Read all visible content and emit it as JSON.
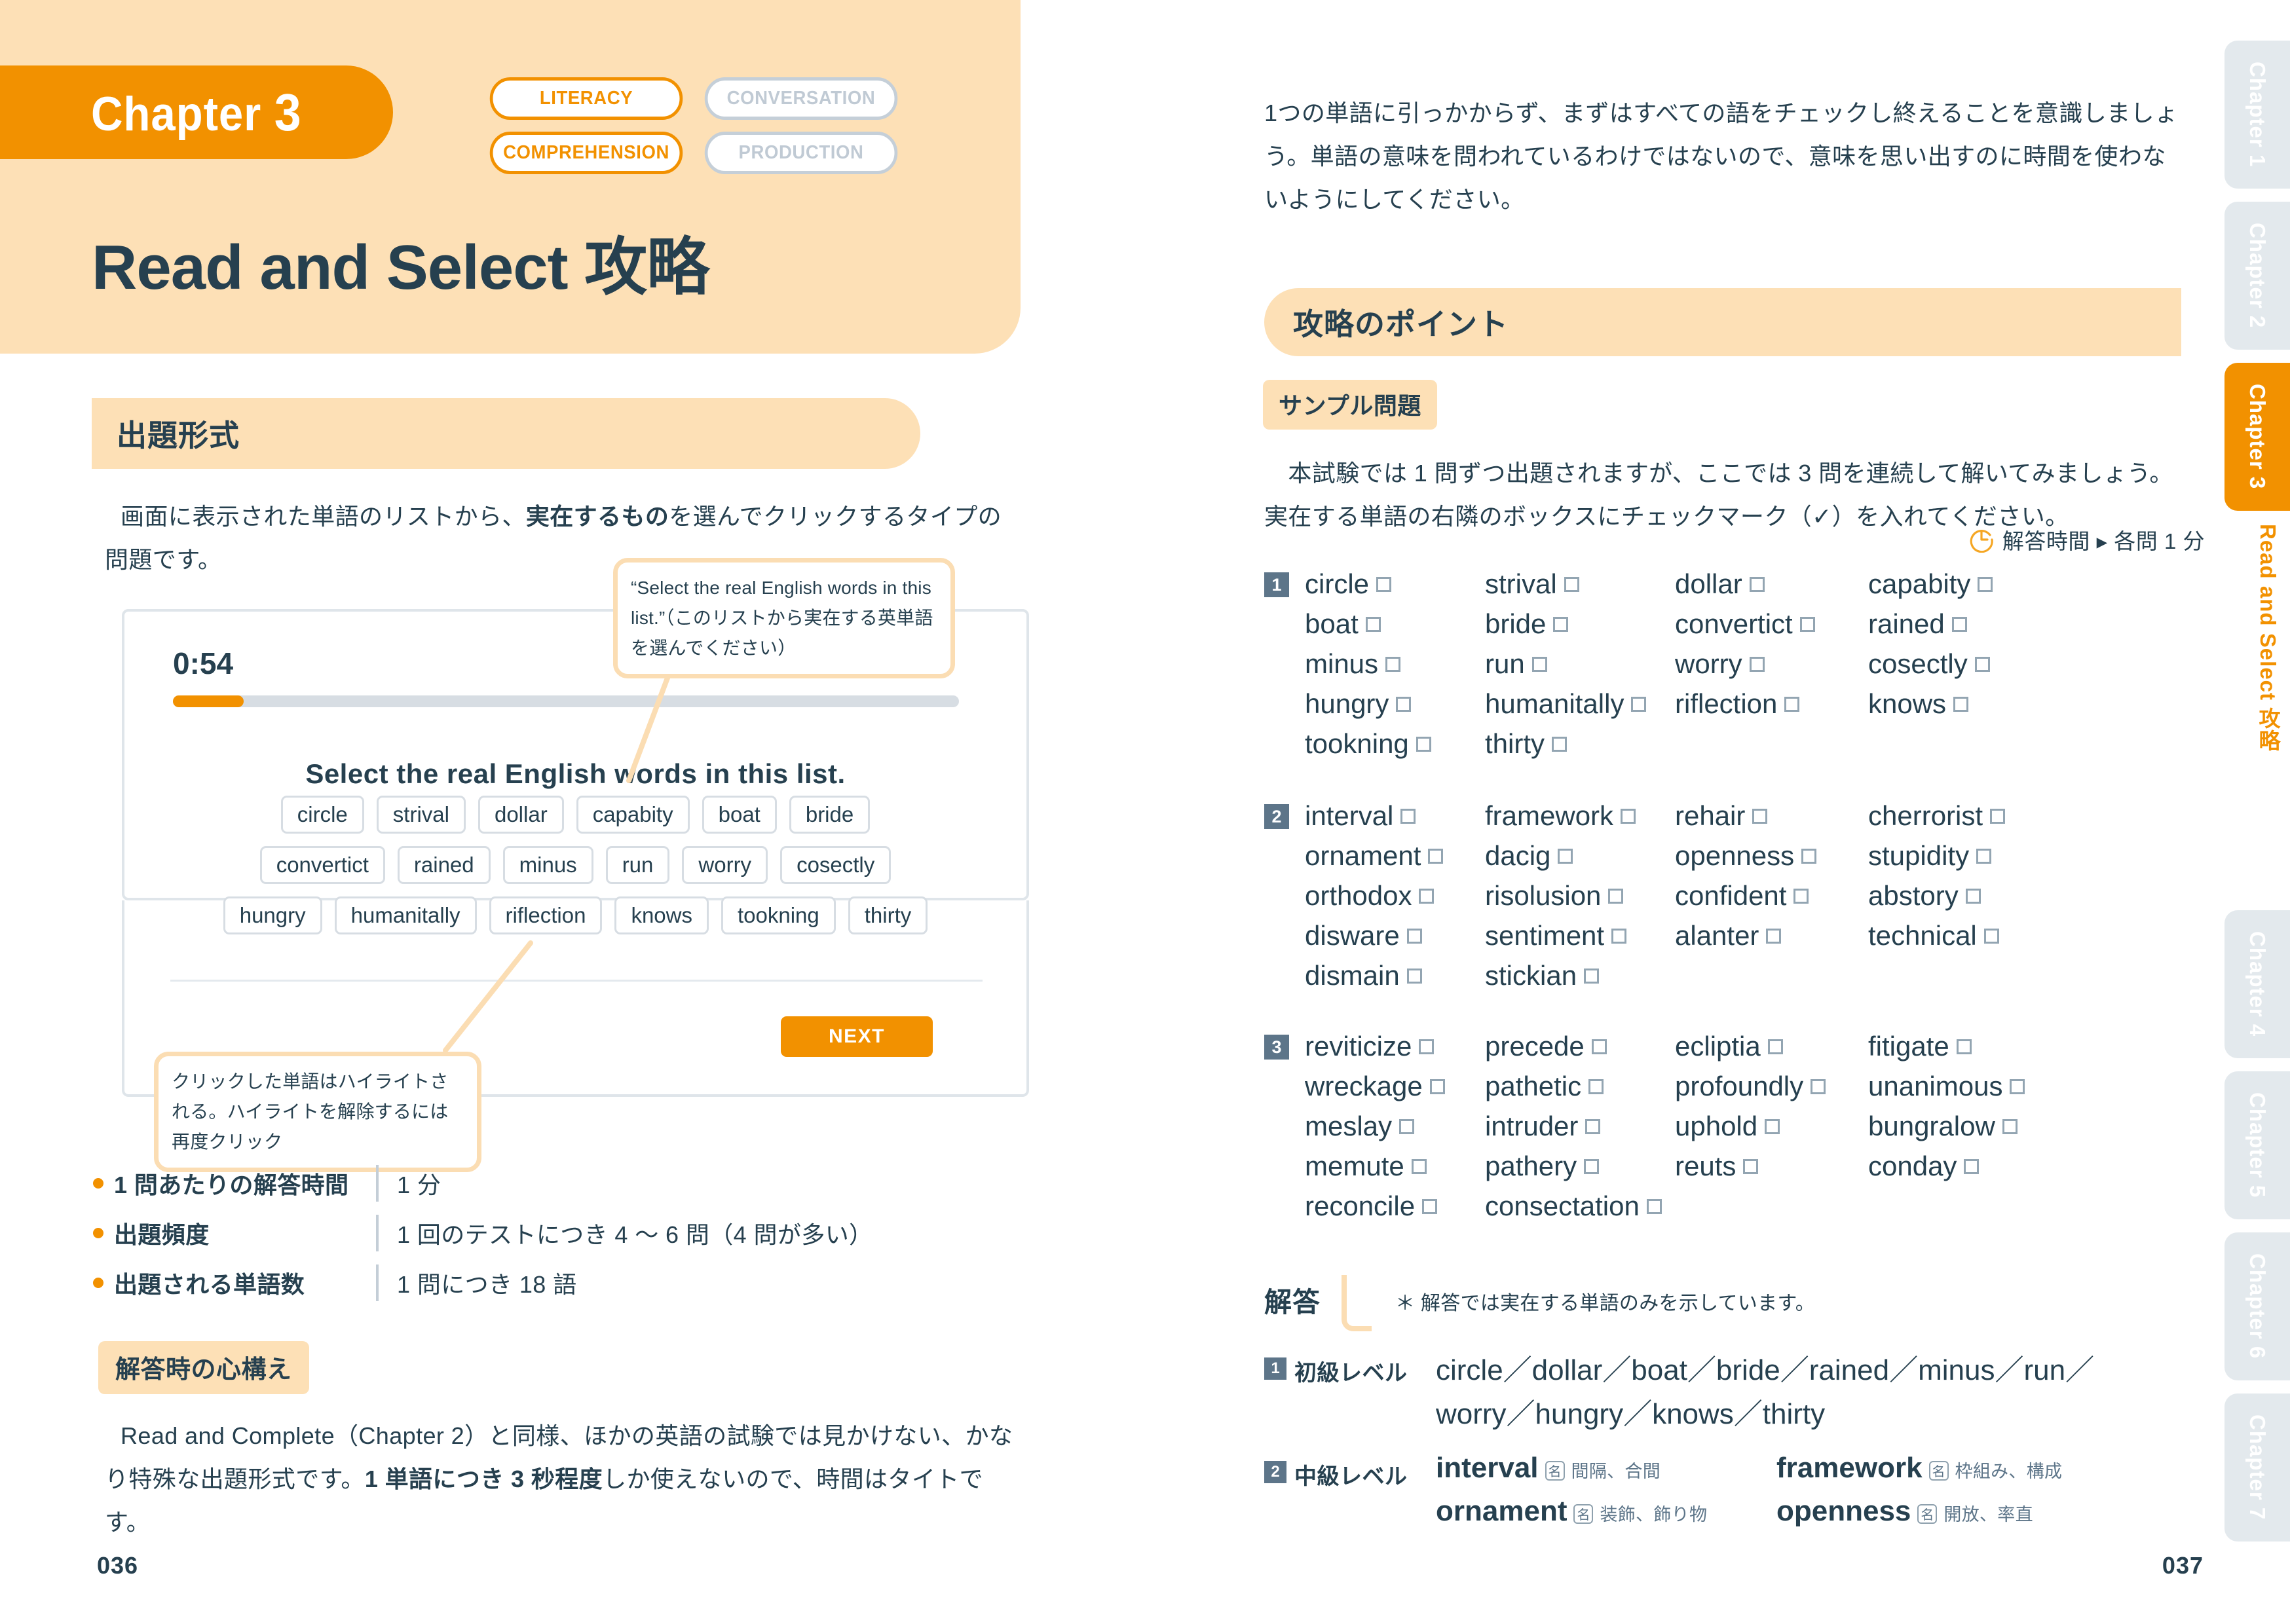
{
  "left": {
    "chapter_label": "Chapter",
    "chapter_number": "3",
    "skill_pills": [
      {
        "label": "LITERACY",
        "active": true
      },
      {
        "label": "CONVERSATION",
        "active": false
      },
      {
        "label": "COMPREHENSION",
        "active": true
      },
      {
        "label": "PRODUCTION",
        "active": false
      }
    ],
    "title": "Read and Select 攻略",
    "section1_heading": "出題形式",
    "section1_paragraph_a": "画面に表示された単語のリストから、",
    "section1_paragraph_b": "実在するもの",
    "section1_paragraph_c": "を選んでクリックするタイプの問題です。",
    "mock": {
      "timer": "0:54",
      "progress_percent": 9,
      "question": "Select the real English words in this list.",
      "next_label": "NEXT",
      "chips": [
        [
          "circle",
          "strival",
          "dollar",
          "capabity",
          "boat",
          "bride"
        ],
        [
          "convertict",
          "rained",
          "minus",
          "run",
          "worry",
          "cosectly"
        ],
        [
          "hungry",
          "humanitally",
          "riflection",
          "knows",
          "tookning",
          "thirty"
        ]
      ]
    },
    "callout_top": "“Select the real English words in this list.”（このリストから実在する英単語を選んでください）",
    "callout_bottom": "クリックした単語はハイライトされる。ハイライトを解除するには再度クリック",
    "bullets": [
      {
        "label": "1 問あたりの解答時間",
        "value": "1 分"
      },
      {
        "label": "出題頻度",
        "value": "1 回のテストにつき 4 〜 6 問（4 問が多い）"
      },
      {
        "label": "出題される単語数",
        "value": "1 問につき 18 語"
      }
    ],
    "section2_tag": "解答時の心構え",
    "section2_paragraph_a": "Read and Complete（Chapter 2）と同様、ほかの英語の試験では見かけない、かなり特殊な出題形式です。",
    "section2_paragraph_b": "1 単語につき 3 秒程度",
    "section2_paragraph_c": "しか使えないので、時間はタイトです。",
    "folio": "036"
  },
  "right": {
    "intro_paragraph": "1つの単語に引っかからず、まずはすべての語をチェックし終えることを意識しましょう。単語の意味を問われているわけではないので、意味を思い出すのに時間を使わないようにしてください。",
    "points_heading": "攻略のポイント",
    "sample_tag": "サンプル問題",
    "sample_paragraph": "　本試験では 1 問ずつ出題されますが、ここでは 3 問を連続して解いてみましょう。実在する単語の右隣のボックスにチェックマーク（✓）を入れてください。",
    "time_note": "解答時間 ▸ 各問 1 分",
    "exercises": [
      {
        "number": "1",
        "words": [
          "circle",
          "strival",
          "dollar",
          "capabity",
          "boat",
          "bride",
          "convertict",
          "rained",
          "minus",
          "run",
          "worry",
          "cosectly",
          "hungry",
          "humanitally",
          "riflection",
          "knows",
          "tookning",
          "thirty"
        ]
      },
      {
        "number": "2",
        "words": [
          "interval",
          "framework",
          "rehair",
          "cherrorist",
          "ornament",
          "dacig",
          "openness",
          "stupidity",
          "orthodox",
          "risolusion",
          "confident",
          "abstory",
          "disware",
          "sentiment",
          "alanter",
          "technical",
          "dismain",
          "stickian"
        ]
      },
      {
        "number": "3",
        "words": [
          "reviticize",
          "precede",
          "ecliptia",
          "fitigate",
          "wreckage",
          "pathetic",
          "profoundly",
          "unanimous",
          "meslay",
          "intruder",
          "uphold",
          "bungralow",
          "memute",
          "pathery",
          "reuts",
          "conday",
          "reconcile",
          "consectation"
        ]
      }
    ],
    "answers": {
      "title": "解答",
      "note": "＊ 解答では実在する単語のみを示しています。",
      "rows": [
        {
          "badge": "1",
          "level": "初級レベル",
          "lines": [
            "circle／dollar／boat／bride／rained／minus／run／",
            "worry／hungry／knows／thirty"
          ]
        },
        {
          "badge": "2",
          "level": "中級レベル",
          "pairs": [
            {
              "word": "interval",
              "pos": "名",
              "jp": "間隔、合間"
            },
            {
              "word": "framework",
              "pos": "名",
              "jp": "枠組み、構成"
            },
            {
              "word": "ornament",
              "pos": "名",
              "jp": "装飾、飾り物"
            },
            {
              "word": "openness",
              "pos": "名",
              "jp": "開放、率直"
            }
          ]
        }
      ]
    },
    "folio": "037"
  },
  "side_tabs": [
    {
      "label": "Chapter 1",
      "active": false
    },
    {
      "label": "Chapter 2",
      "active": false
    },
    {
      "label": "Chapter 3",
      "active": true
    },
    {
      "label": "Chapter 4",
      "active": false
    },
    {
      "label": "Chapter 5",
      "active": false
    },
    {
      "label": "Chapter 6",
      "active": false
    },
    {
      "label": "Chapter 7",
      "active": false
    }
  ],
  "side_tab_active_title": "Read and Select 攻略",
  "colors": {
    "accent_orange": "#f29100",
    "soft_orange": "#fde0b6",
    "ink": "#26404f",
    "grey_tab": "#e3e9ed",
    "slate": "#5d7589"
  }
}
